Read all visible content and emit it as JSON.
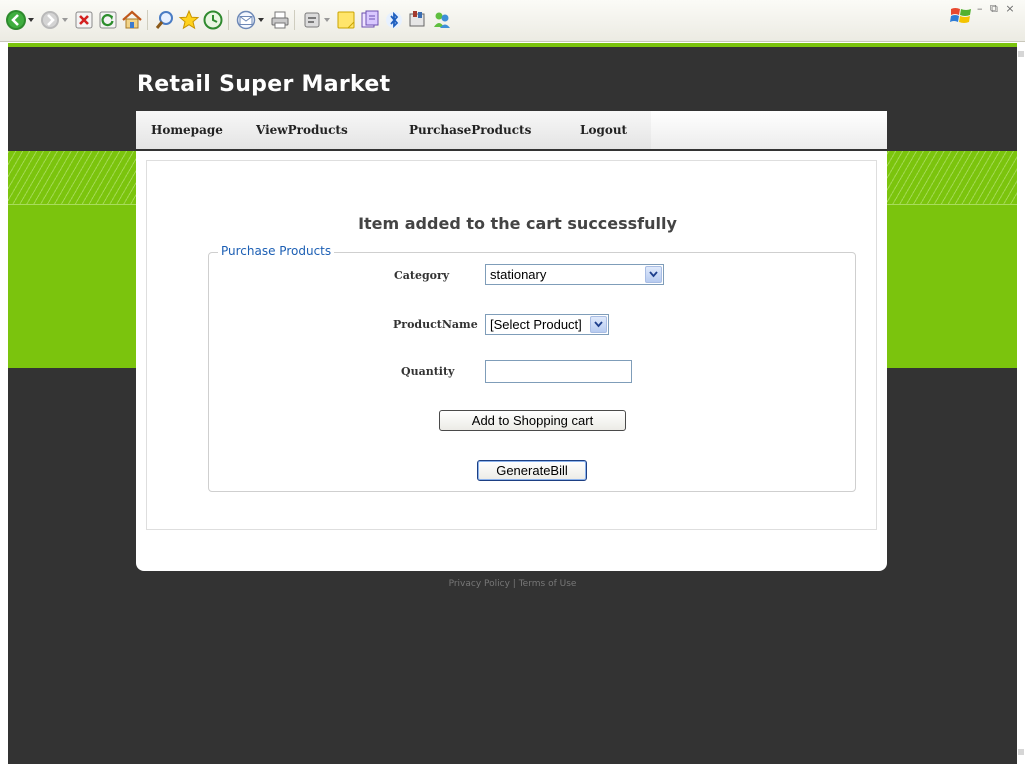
{
  "browser": {
    "toolbar_icons": [
      "back-icon",
      "forward-icon",
      "stop-icon",
      "refresh-icon",
      "home-icon",
      "search-icon",
      "favorites-icon",
      "history-icon",
      "mail-icon",
      "print-icon",
      "edit-icon",
      "notes-icon",
      "research-icon",
      "bluetooth-icon",
      "messenger-icon",
      "users-icon"
    ],
    "window_controls": "– ⧉ ×"
  },
  "site": {
    "title": "Retail Super Market",
    "nav": [
      "Homepage",
      "ViewProducts",
      "PurchaseProducts",
      "Logout"
    ]
  },
  "main": {
    "status_message": "Item added to the cart successfully",
    "form": {
      "legend": "Purchase Products",
      "category_label": "Category",
      "category_value": "stationary",
      "product_label": "ProductName",
      "product_value": "[Select Product]",
      "quantity_label": "Quantity",
      "quantity_value": "",
      "add_button": "Add to Shopping cart",
      "bill_button": "GenerateBill"
    }
  },
  "footer": {
    "privacy": "Privacy Policy",
    "separator": "|",
    "terms": "Terms of Use"
  },
  "colors": {
    "accent_green": "#7bc40d",
    "dark_bg": "#333333",
    "legend_blue": "#1c5fb4"
  }
}
